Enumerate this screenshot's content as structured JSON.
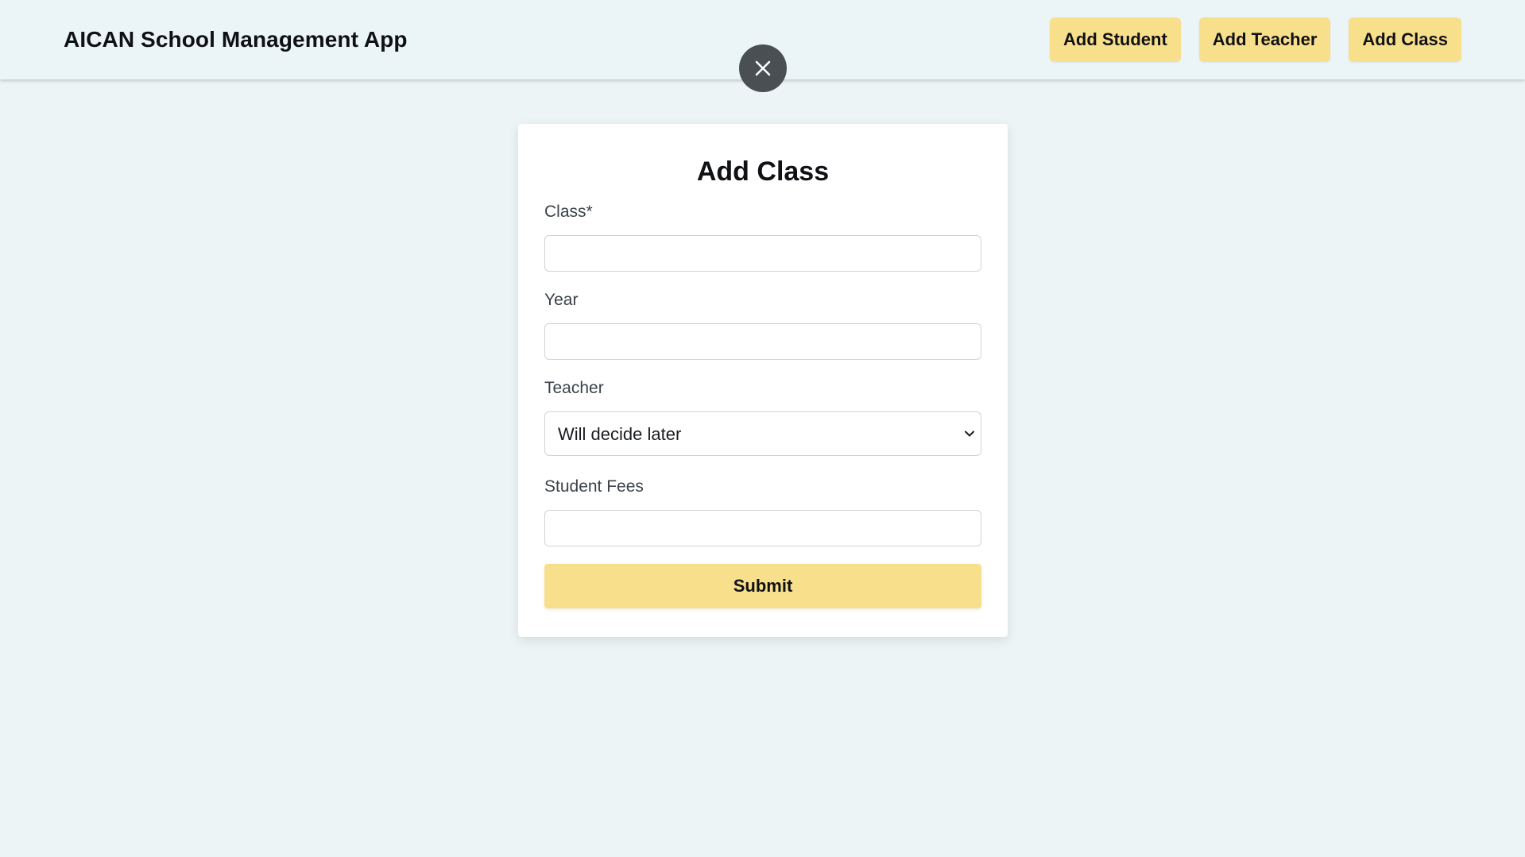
{
  "header": {
    "app_title": "AICAN School Management App",
    "nav": [
      {
        "label": "Add Student"
      },
      {
        "label": "Add Teacher"
      },
      {
        "label": "Add Class"
      }
    ]
  },
  "close_button": {
    "icon": "close-icon"
  },
  "form": {
    "title": "Add Class",
    "fields": {
      "class": {
        "label": "Class*",
        "value": ""
      },
      "year": {
        "label": "Year",
        "value": ""
      },
      "teacher": {
        "label": "Teacher",
        "selected": "Will decide later"
      },
      "student_fees": {
        "label": "Student Fees",
        "value": ""
      }
    },
    "submit_label": "Submit"
  },
  "colors": {
    "background": "#ecf4f6",
    "accent": "#f8df8c",
    "close_button": "#4a4f53"
  }
}
